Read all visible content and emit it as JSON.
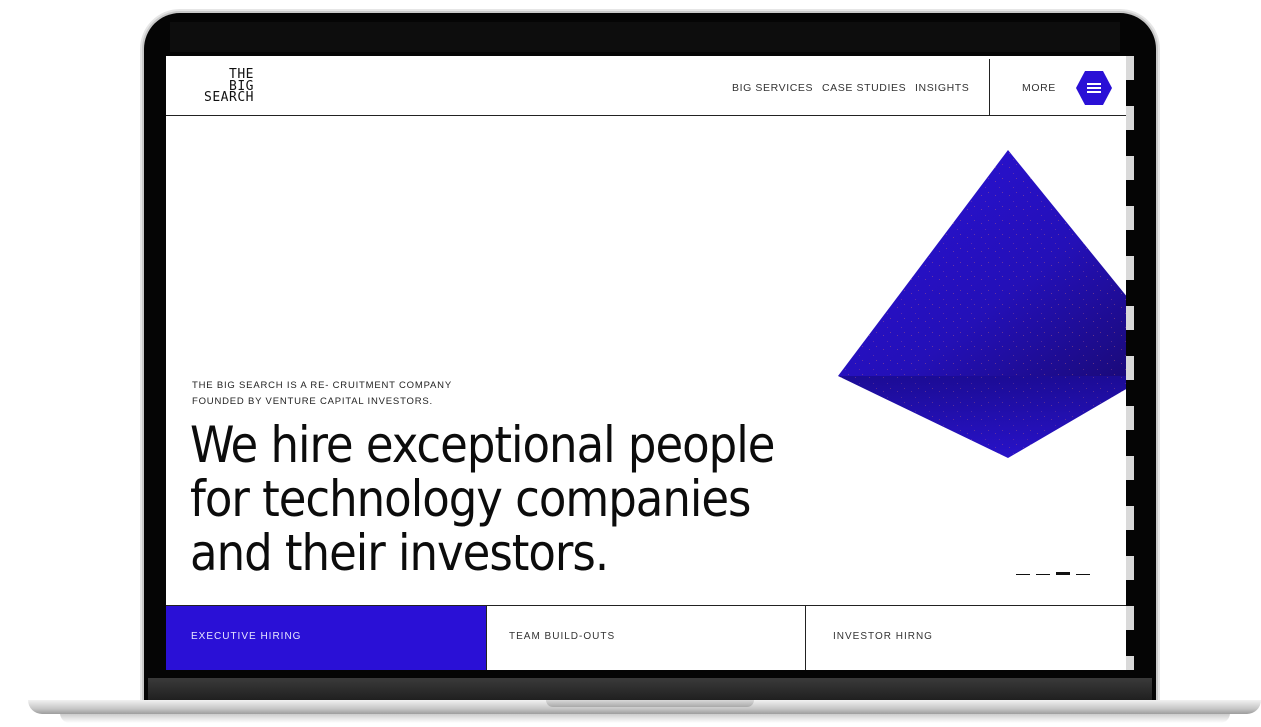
{
  "brand": {
    "logo_lines": [
      "THE",
      "BIG",
      "SEARCH"
    ]
  },
  "nav": {
    "items": [
      "BIG SERVICES",
      "CASE STUDIES",
      "INSIGHTS"
    ],
    "more_label": "MORE",
    "menu_icon": "hamburger-icon"
  },
  "hero": {
    "intro_lines": [
      "THE BIG SEARCH IS A RE- CRUITMENT COMPANY",
      "FOUNDED BY VENTURE CAPITAL INVESTORS."
    ],
    "headline_lines": [
      "We hire exceptional people",
      "for technology companies",
      "and their investors."
    ],
    "slide_count": 4,
    "active_slide": 3
  },
  "tabs": [
    {
      "label": "EXECUTIVE HIRING",
      "active": true
    },
    {
      "label": "TEAM BUILD-OUTS",
      "active": false
    },
    {
      "label": "INVESTOR HIRNG",
      "active": false
    }
  ],
  "colors": {
    "accent": "#2a10d6",
    "text": "#0c0c0c"
  }
}
